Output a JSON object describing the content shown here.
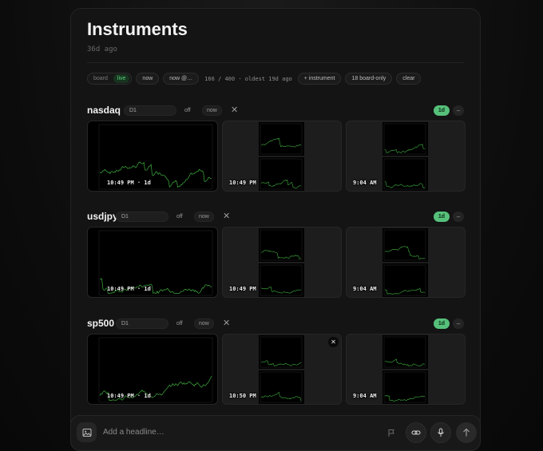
{
  "header": {
    "title": "Instruments",
    "subtitle": "36d ago"
  },
  "toolbar": {
    "mode_board": "board",
    "mode_live": "live",
    "now_label": "now",
    "now_at_label": "now @…",
    "status": "166 / 400 · oldest 19d ago",
    "add_instrument": "+ instrument",
    "board_only": "18 board-only",
    "clear": "clear"
  },
  "sections": [
    {
      "name": "nasdaq",
      "timeframe": "D1",
      "off_label": "off",
      "now_label": "now",
      "close_glyph": "✕",
      "range": "1d",
      "collapse_glyph": "–",
      "cards": [
        {
          "time": "10:49 PM · 1d"
        },
        {
          "time": "10:49 PM"
        },
        {
          "time": "9:04 AM"
        }
      ]
    },
    {
      "name": "usdjpy",
      "timeframe": "D1",
      "off_label": "off",
      "now_label": "now",
      "close_glyph": "✕",
      "range": "1d",
      "collapse_glyph": "–",
      "cards": [
        {
          "time": "10:49 PM · 1d"
        },
        {
          "time": "10:49 PM"
        },
        {
          "time": "9:04 AM"
        }
      ]
    },
    {
      "name": "sp500",
      "timeframe": "D1",
      "off_label": "off",
      "now_label": "now",
      "close_glyph": "✕",
      "range": "1d",
      "collapse_glyph": "–",
      "cards": [
        {
          "time": "10:49 PM · 1d"
        },
        {
          "time": "10:50 PM",
          "close_glyph": "✕"
        },
        {
          "time": "9:04 AM"
        }
      ]
    }
  ],
  "composer": {
    "placeholder": "Add a headline…"
  },
  "icons": {
    "image": "image-icon",
    "flag": "flag-icon",
    "link": "link-icon",
    "mic": "mic-icon",
    "send": "arrow-up-icon"
  },
  "colors": {
    "accent_green": "#56c07a",
    "chart_line": "#3fae3f",
    "panel_bg": "#141414"
  }
}
